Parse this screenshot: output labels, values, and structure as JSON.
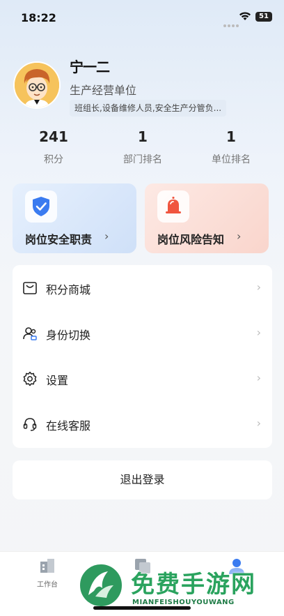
{
  "status_bar": {
    "time": "18:22",
    "battery": "51"
  },
  "profile": {
    "name": "宁一二",
    "org": "生产经营单位",
    "roles": "班组长,设备维修人员,安全生产分管负..."
  },
  "stats": [
    {
      "value": "241",
      "label": "积分"
    },
    {
      "value": "1",
      "label": "部门排名"
    },
    {
      "value": "1",
      "label": "单位排名"
    }
  ],
  "cards": {
    "safety": {
      "label": "岗位安全职责",
      "icon": "shield-check-icon"
    },
    "risk": {
      "label": "岗位风险告知",
      "icon": "alarm-bell-icon"
    }
  },
  "menu": [
    {
      "label": "积分商城",
      "icon": "shop-icon"
    },
    {
      "label": "身份切换",
      "icon": "switch-user-icon"
    },
    {
      "label": "设置",
      "icon": "gear-icon"
    },
    {
      "label": "在线客服",
      "icon": "headset-icon"
    }
  ],
  "logout_label": "退出登录",
  "tabbar": [
    {
      "label": "工作台",
      "icon": "workbench-icon"
    },
    {
      "label": "",
      "icon": "tasks-icon"
    },
    {
      "label": "",
      "icon": "profile-icon"
    }
  ],
  "watermark": {
    "title": "免费手游网",
    "subtitle": "MIANFEISHOUYOUWANG"
  },
  "colors": {
    "accent_blue": "#3a7bf0",
    "alert_red": "#f0553f",
    "watermark_green": "#2aa35e"
  }
}
